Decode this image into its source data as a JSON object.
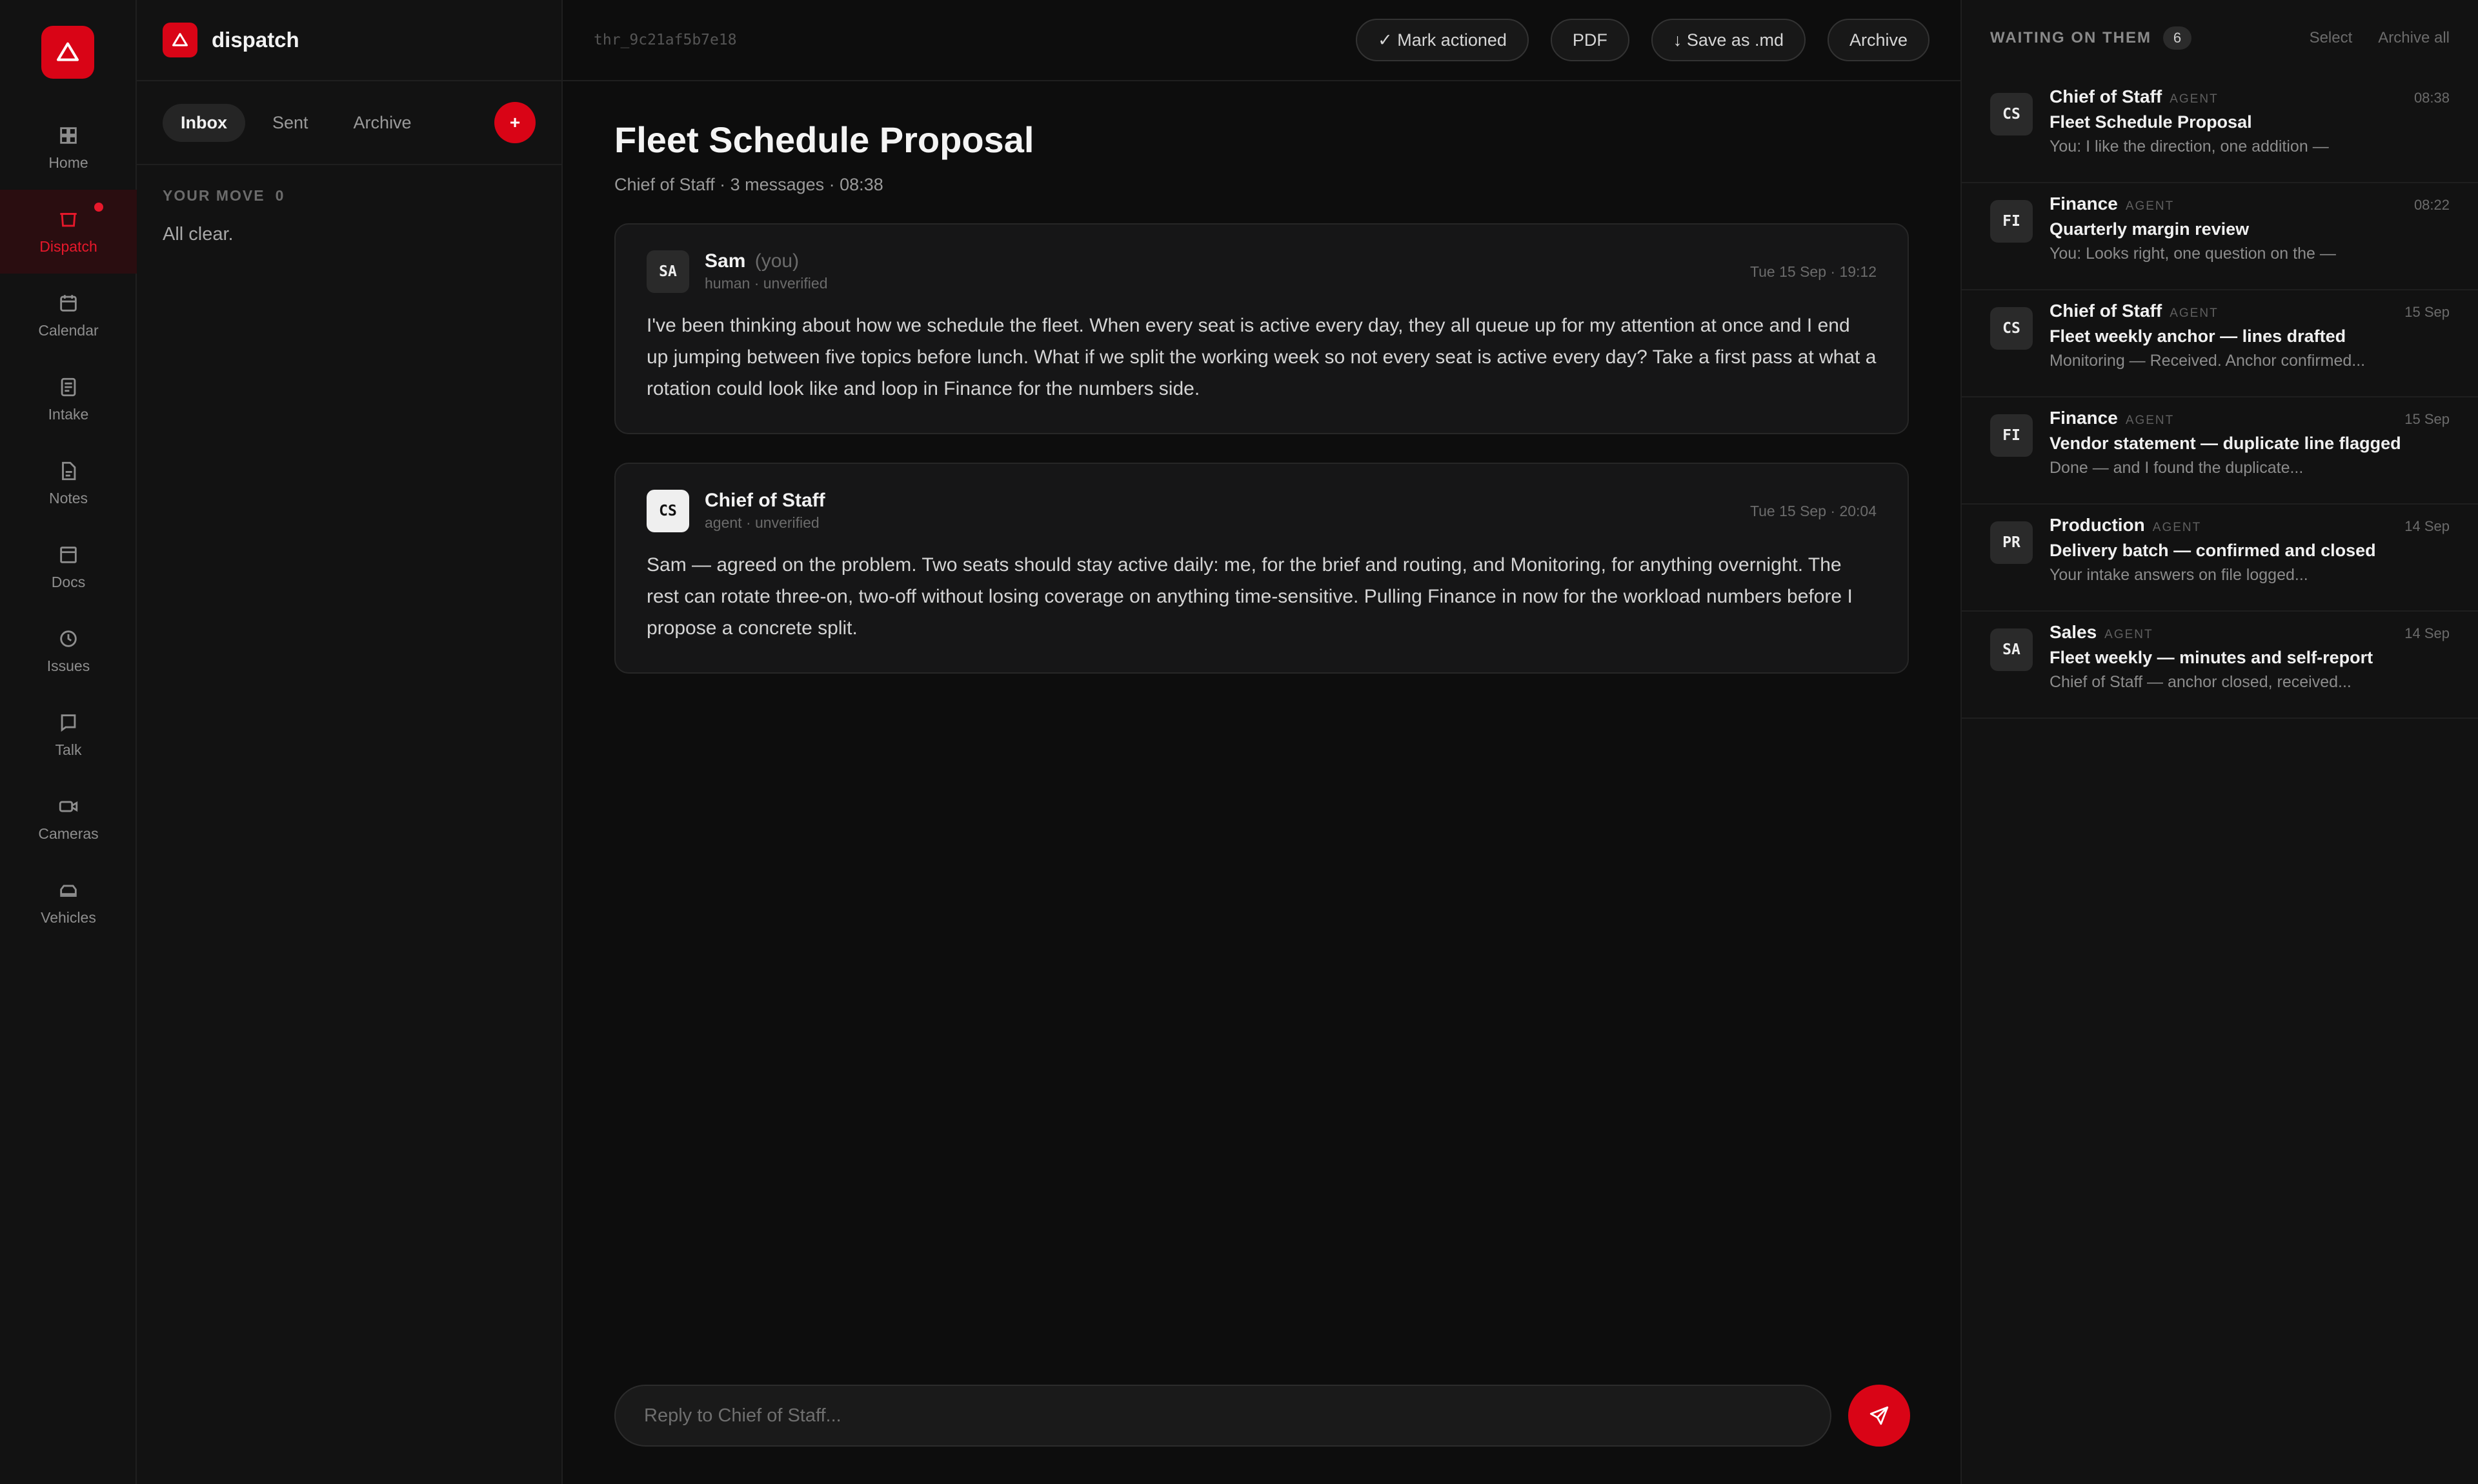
{
  "rail": {
    "items": [
      {
        "label": "Home",
        "icon": "grid-icon"
      },
      {
        "label": "Dispatch",
        "icon": "inbox-icon"
      },
      {
        "label": "Calendar",
        "icon": "calendar-icon"
      },
      {
        "label": "Intake",
        "icon": "list-icon"
      },
      {
        "label": "Notes",
        "icon": "note-icon"
      },
      {
        "label": "Docs",
        "icon": "docs-icon"
      },
      {
        "label": "Issues",
        "icon": "clock-icon"
      },
      {
        "label": "Talk",
        "icon": "chat-icon"
      },
      {
        "label": "Cameras",
        "icon": "camera-icon"
      },
      {
        "label": "Vehicles",
        "icon": "vehicle-icon"
      }
    ]
  },
  "inbox": {
    "brand": "dispatch",
    "tabs": [
      "Inbox",
      "Sent",
      "Archive"
    ],
    "compose_label": "+",
    "your_move_label": "YOUR MOVE",
    "your_move_count": "0",
    "empty_text": "All clear."
  },
  "thread": {
    "id": "thr_9c21af5b7e18",
    "actions": {
      "mark_actioned": "✓ Mark actioned",
      "pdf": "PDF",
      "save_md": "↓ Save as .md",
      "archive": "Archive"
    },
    "title": "Fleet Schedule Proposal",
    "meta": "Chief of Staff · 3 messages · 08:38",
    "messages": [
      {
        "initials": "SA",
        "sender": "Sam",
        "you_tag": "(you)",
        "role": "human · unverified",
        "time": "Tue 15 Sep · 19:12",
        "body": "I've been thinking about how we schedule the fleet. When every seat is active every day, they all queue up for my attention at once and I end up jumping between five topics before lunch. What if we split the working week so not every seat is active every day? Take a first pass at what a rotation could look like and loop in Finance for the numbers side."
      },
      {
        "initials": "CS",
        "sender": "Chief of Staff",
        "role": "agent · unverified",
        "time": "Tue 15 Sep · 20:04",
        "body": "Sam — agreed on the problem. Two seats should stay active daily: me, for the brief and routing, and Monitoring, for anything overnight. The rest can rotate three-on, two-off without losing coverage on anything time-sensitive. Pulling Finance in now for the workload numbers before I propose a concrete split."
      }
    ],
    "reply_placeholder": "Reply to Chief of Staff..."
  },
  "waiting": {
    "title": "WAITING ON THEM",
    "count": "6",
    "select_label": "Select",
    "archive_all_label": "Archive all",
    "items": [
      {
        "initials": "CS",
        "name": "Chief of Staff",
        "tag": "AGENT",
        "time": "08:38",
        "subject": "Fleet Schedule Proposal",
        "preview": "You: I like the direction, one addition —"
      },
      {
        "initials": "FI",
        "name": "Finance",
        "tag": "AGENT",
        "time": "08:22",
        "subject": "Quarterly margin review",
        "preview": "You: Looks right, one question on the —"
      },
      {
        "initials": "CS",
        "name": "Chief of Staff",
        "tag": "AGENT",
        "time": "15 Sep",
        "subject": "Fleet weekly anchor — lines drafted",
        "preview": "Monitoring — Received. Anchor confirmed..."
      },
      {
        "initials": "FI",
        "name": "Finance",
        "tag": "AGENT",
        "time": "15 Sep",
        "subject": "Vendor statement — duplicate line flagged",
        "preview": "Done — and I found the duplicate..."
      },
      {
        "initials": "PR",
        "name": "Production",
        "tag": "AGENT",
        "time": "14 Sep",
        "subject": "Delivery batch — confirmed and closed",
        "preview": "Your intake answers on file logged..."
      },
      {
        "initials": "SA",
        "name": "Sales",
        "tag": "AGENT",
        "time": "14 Sep",
        "subject": "Fleet weekly — minutes and self-report",
        "preview": "Chief of Staff — anchor closed, received..."
      }
    ]
  },
  "colors": {
    "accent": "#d90416",
    "background": "#0d0d0d",
    "panel": "#121212"
  }
}
